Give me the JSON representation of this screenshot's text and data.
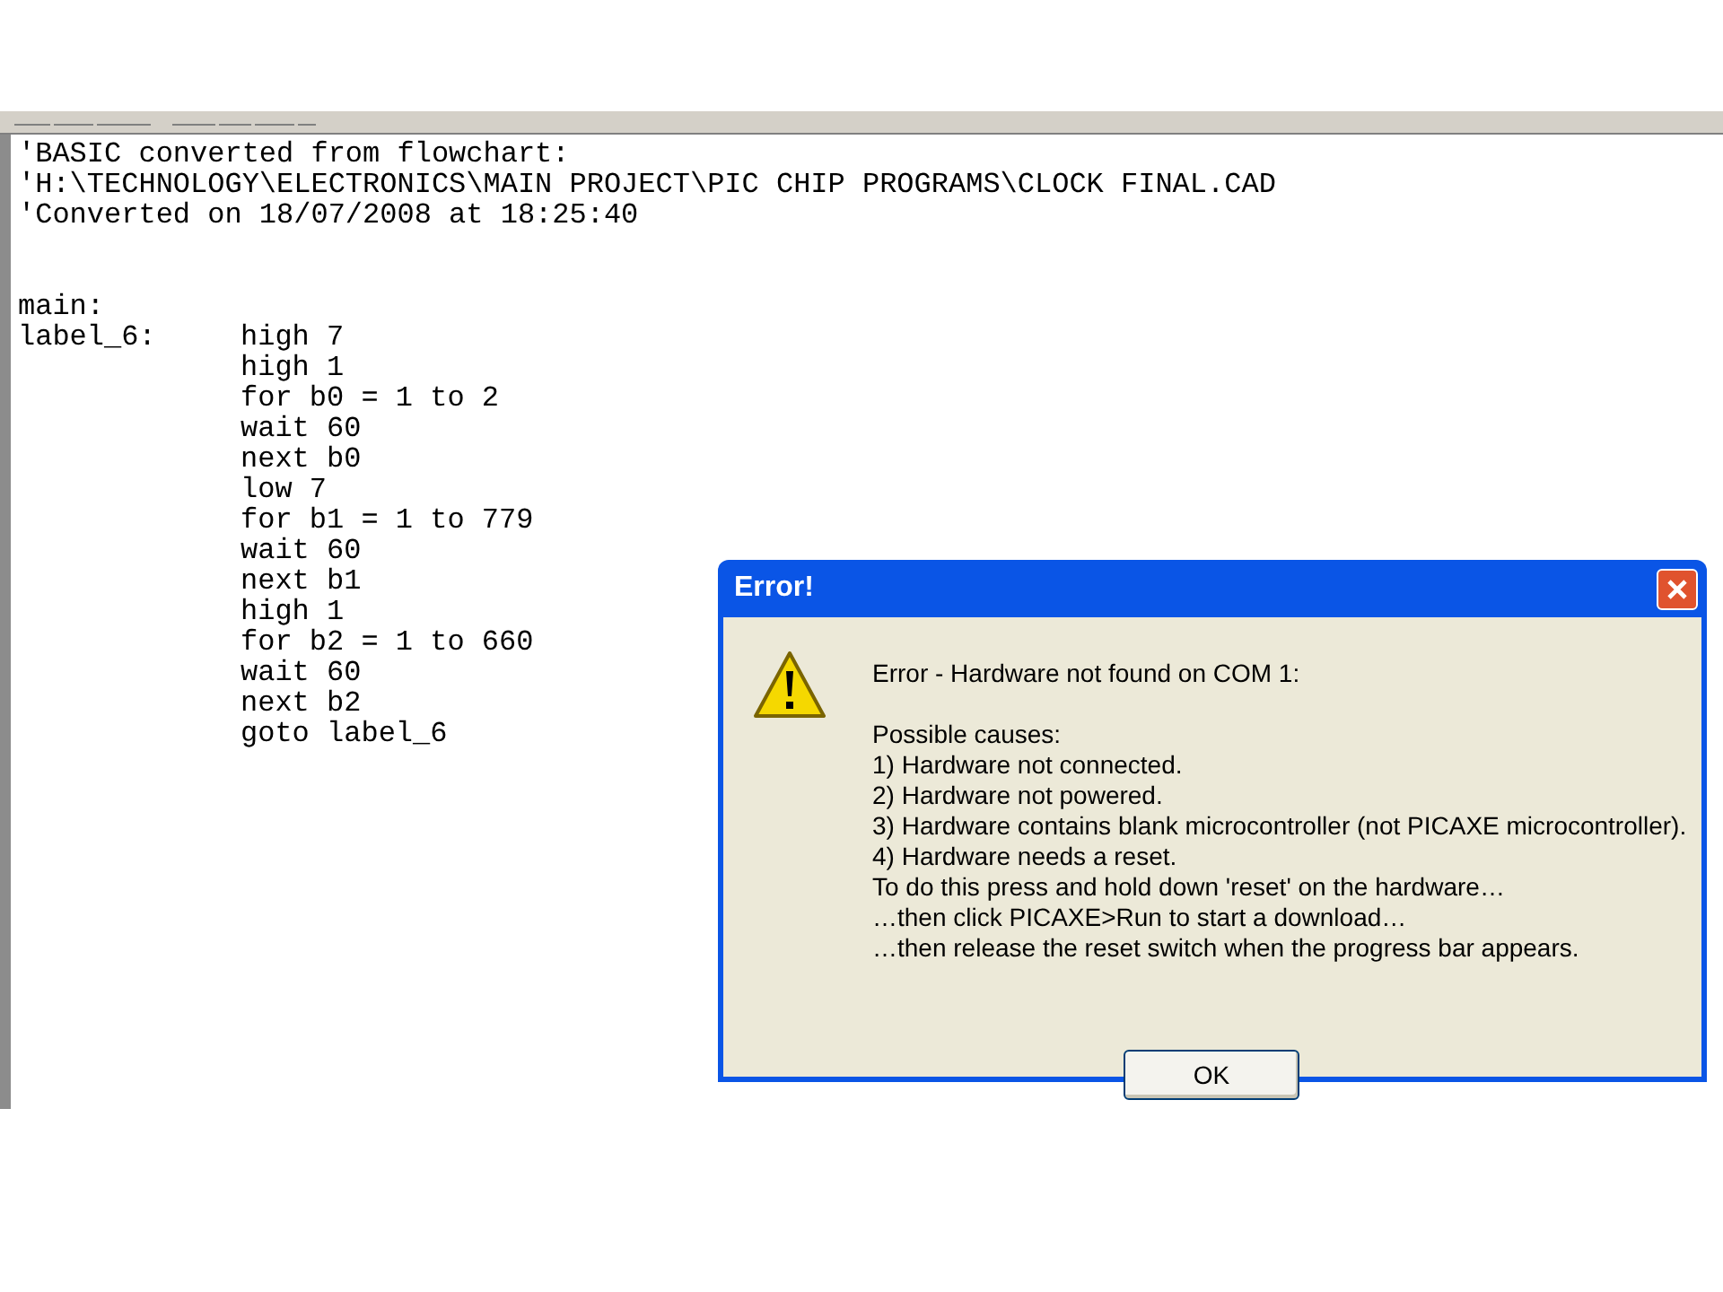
{
  "editor": {
    "comment_lines": [
      "'BASIC converted from flowchart:",
      "'H:\\TECHNOLOGY\\ELECTRONICS\\MAIN PROJECT\\PIC CHIP PROGRAMS\\CLOCK FINAL.CAD",
      "'Converted on 18/07/2008 at 18:25:40"
    ],
    "code_lines": [
      {
        "label": "main:"
      },
      {
        "label": "label_6:",
        "statement": "high 7"
      },
      {
        "statement": "high 1"
      },
      {
        "statement": "for b0 = 1 to 2"
      },
      {
        "statement": "wait 60"
      },
      {
        "statement": "next b0"
      },
      {
        "statement": "low 7"
      },
      {
        "statement": "for b1 = 1 to 779"
      },
      {
        "statement": "wait 60"
      },
      {
        "statement": "next b1"
      },
      {
        "statement": "high 1"
      },
      {
        "statement": "for b2 = 1 to 660"
      },
      {
        "statement": "wait 60"
      },
      {
        "statement": "next b2"
      },
      {
        "statement": "goto label_6"
      }
    ]
  },
  "dialog": {
    "title": "Error!",
    "heading": "Error - Hardware not found on COM 1:",
    "lines": [
      "Possible causes:",
      "1) Hardware not connected.",
      "2) Hardware not powered.",
      "3) Hardware contains blank microcontroller (not PICAXE microcontroller).",
      "4) Hardware needs a reset.",
      "To do this press and hold down 'reset' on the hardware…",
      "…then click PICAXE>Run to start a download…",
      "…then release the reset switch when the progress bar appears."
    ],
    "buttons": [
      "OK"
    ]
  }
}
